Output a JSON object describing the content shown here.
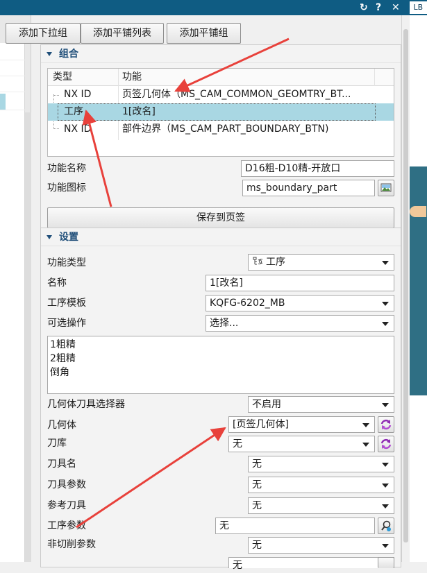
{
  "window": {
    "title_fragment": " LB",
    "refresh_glyph": "↻",
    "help_glyph": "?",
    "close_glyph": "✕"
  },
  "toolbar": {
    "add_dropdown_label": "添加下拉组",
    "add_tiled_list_label": "添加平铺列表",
    "add_tiled_group_label": "添加平铺组"
  },
  "group_section": {
    "title": "组合",
    "table": {
      "columns": [
        "类型",
        "功能"
      ],
      "rows": [
        {
          "type": "NX ID",
          "function": "页签几何体（MS_CAM_COMMON_GEOMTRY_BT...",
          "selected": false
        },
        {
          "type": "工序",
          "function": "1[改名]",
          "selected": true
        },
        {
          "type": "NX ID",
          "function": "部件边界（MS_CAM_PART_BOUNDARY_BTN)",
          "selected": false
        }
      ]
    },
    "function_name_label": "功能名称",
    "function_name_value": "D16粗-D10精-开放口",
    "function_icon_label": "功能图标",
    "function_icon_value": "ms_boundary_part",
    "save_button_label": "保存到页签"
  },
  "settings_section": {
    "title": "设置",
    "function_type_label": "功能类型",
    "function_type_value": "工序",
    "name_label": "名称",
    "name_value": "1[改名]",
    "template_label": "工序模板",
    "template_value": "KQFG-6202_MB",
    "optional_ops_label": "可选操作",
    "optional_ops_value": "选择...",
    "ops_list": [
      "1粗精",
      "2粗精",
      "倒角"
    ],
    "geom_tool_selector_label": "几何体刀具选择器",
    "geom_tool_selector_value": "不启用",
    "geometry_label": "几何体",
    "geometry_value": "[页签几何体]",
    "tool_library_label": "刀库",
    "tool_library_value": "无",
    "tool_name_label": "刀具名",
    "tool_name_value": "无",
    "tool_params_label": "刀具参数",
    "tool_params_value": "无",
    "ref_tool_label": "参考刀具",
    "ref_tool_value": "无",
    "op_params_label": "工序参数",
    "op_params_value": "无",
    "noncut_params_label": "非切削参数",
    "noncut_params_value": "无",
    "last_row_value": "无"
  },
  "colors": {
    "titlebar": "#0f5c83",
    "selection": "#a9d7e3",
    "section_header": "#1f4e79",
    "annotation_arrow": "#e8413b",
    "refresh_icon": "#8e2bb3"
  },
  "icons": {
    "refresh": "refresh-icon",
    "help": "help-icon",
    "close": "close-icon",
    "collapse": "collapse-triangle-icon",
    "image": "image-icon",
    "cycle": "cycle-arrows-icon",
    "search": "search-icon",
    "operation_type": "operation-type-icon"
  }
}
